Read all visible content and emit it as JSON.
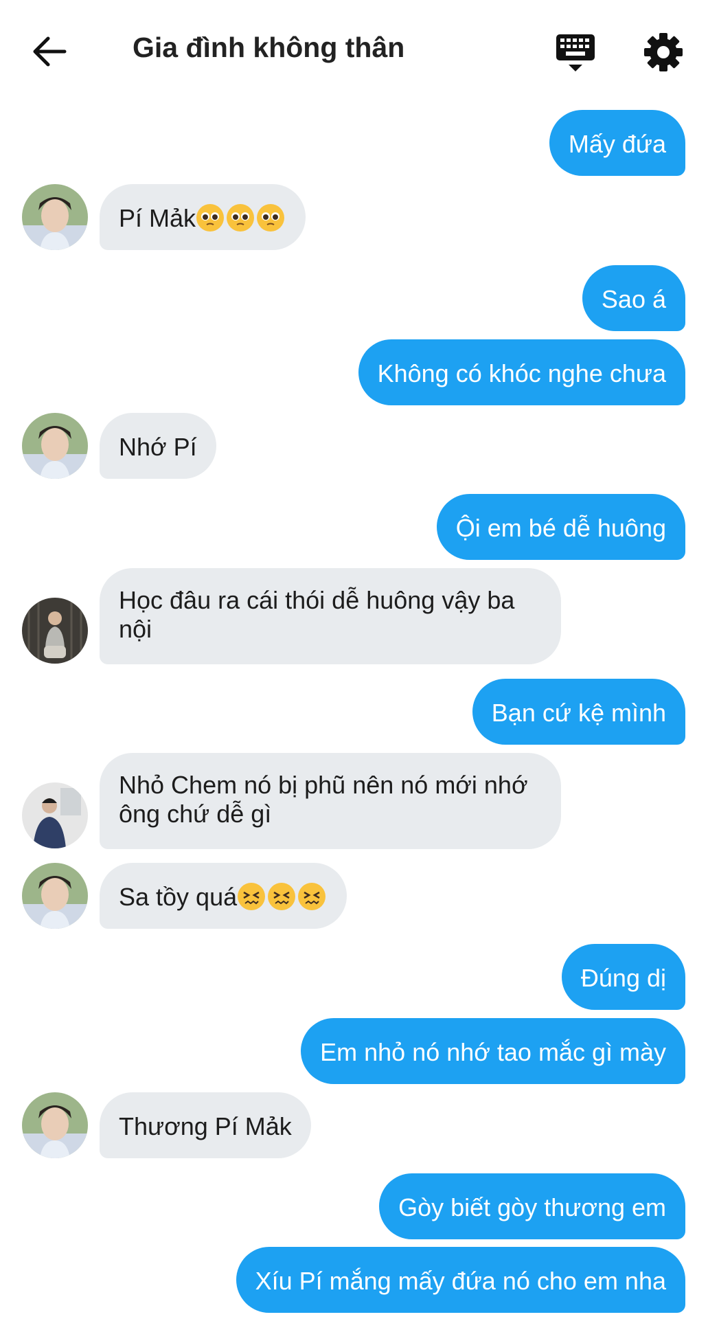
{
  "header": {
    "title": "Gia đình không thân"
  },
  "messages": [
    {
      "text": "Mấy đứa"
    },
    {
      "text": "Pí Mảk",
      "emoji": [
        "pleading-face",
        "pleading-face",
        "pleading-face"
      ]
    },
    {
      "text": "Sao á"
    },
    {
      "text": "Không có khóc nghe chưa"
    },
    {
      "text": "Nhớ Pí"
    },
    {
      "text": "Ội em bé dễ huông"
    },
    {
      "text": "Học đâu ra cái thói dễ huông vậy ba nội"
    },
    {
      "text": "Bạn cứ kệ mình"
    },
    {
      "text": "Nhỏ Chem nó bị phũ nên nó mới nhớ ông chứ dễ gì"
    },
    {
      "text": "Sa tồy quá",
      "emoji": [
        "confounded-face",
        "confounded-face",
        "confounded-face"
      ]
    },
    {
      "text": "Đúng dị"
    },
    {
      "text": "Em nhỏ nó nhớ tao mắc gì mày"
    },
    {
      "text": "Thương Pí Mảk"
    },
    {
      "text": "Gòy biết gòy thương em"
    },
    {
      "text": "Xíu Pí mắng mấy đứa nó cho em nha"
    }
  ],
  "colors": {
    "outgoing_bubble": "#1da1f2",
    "incoming_bubble": "#e8ebee",
    "background": "#ffffff"
  }
}
